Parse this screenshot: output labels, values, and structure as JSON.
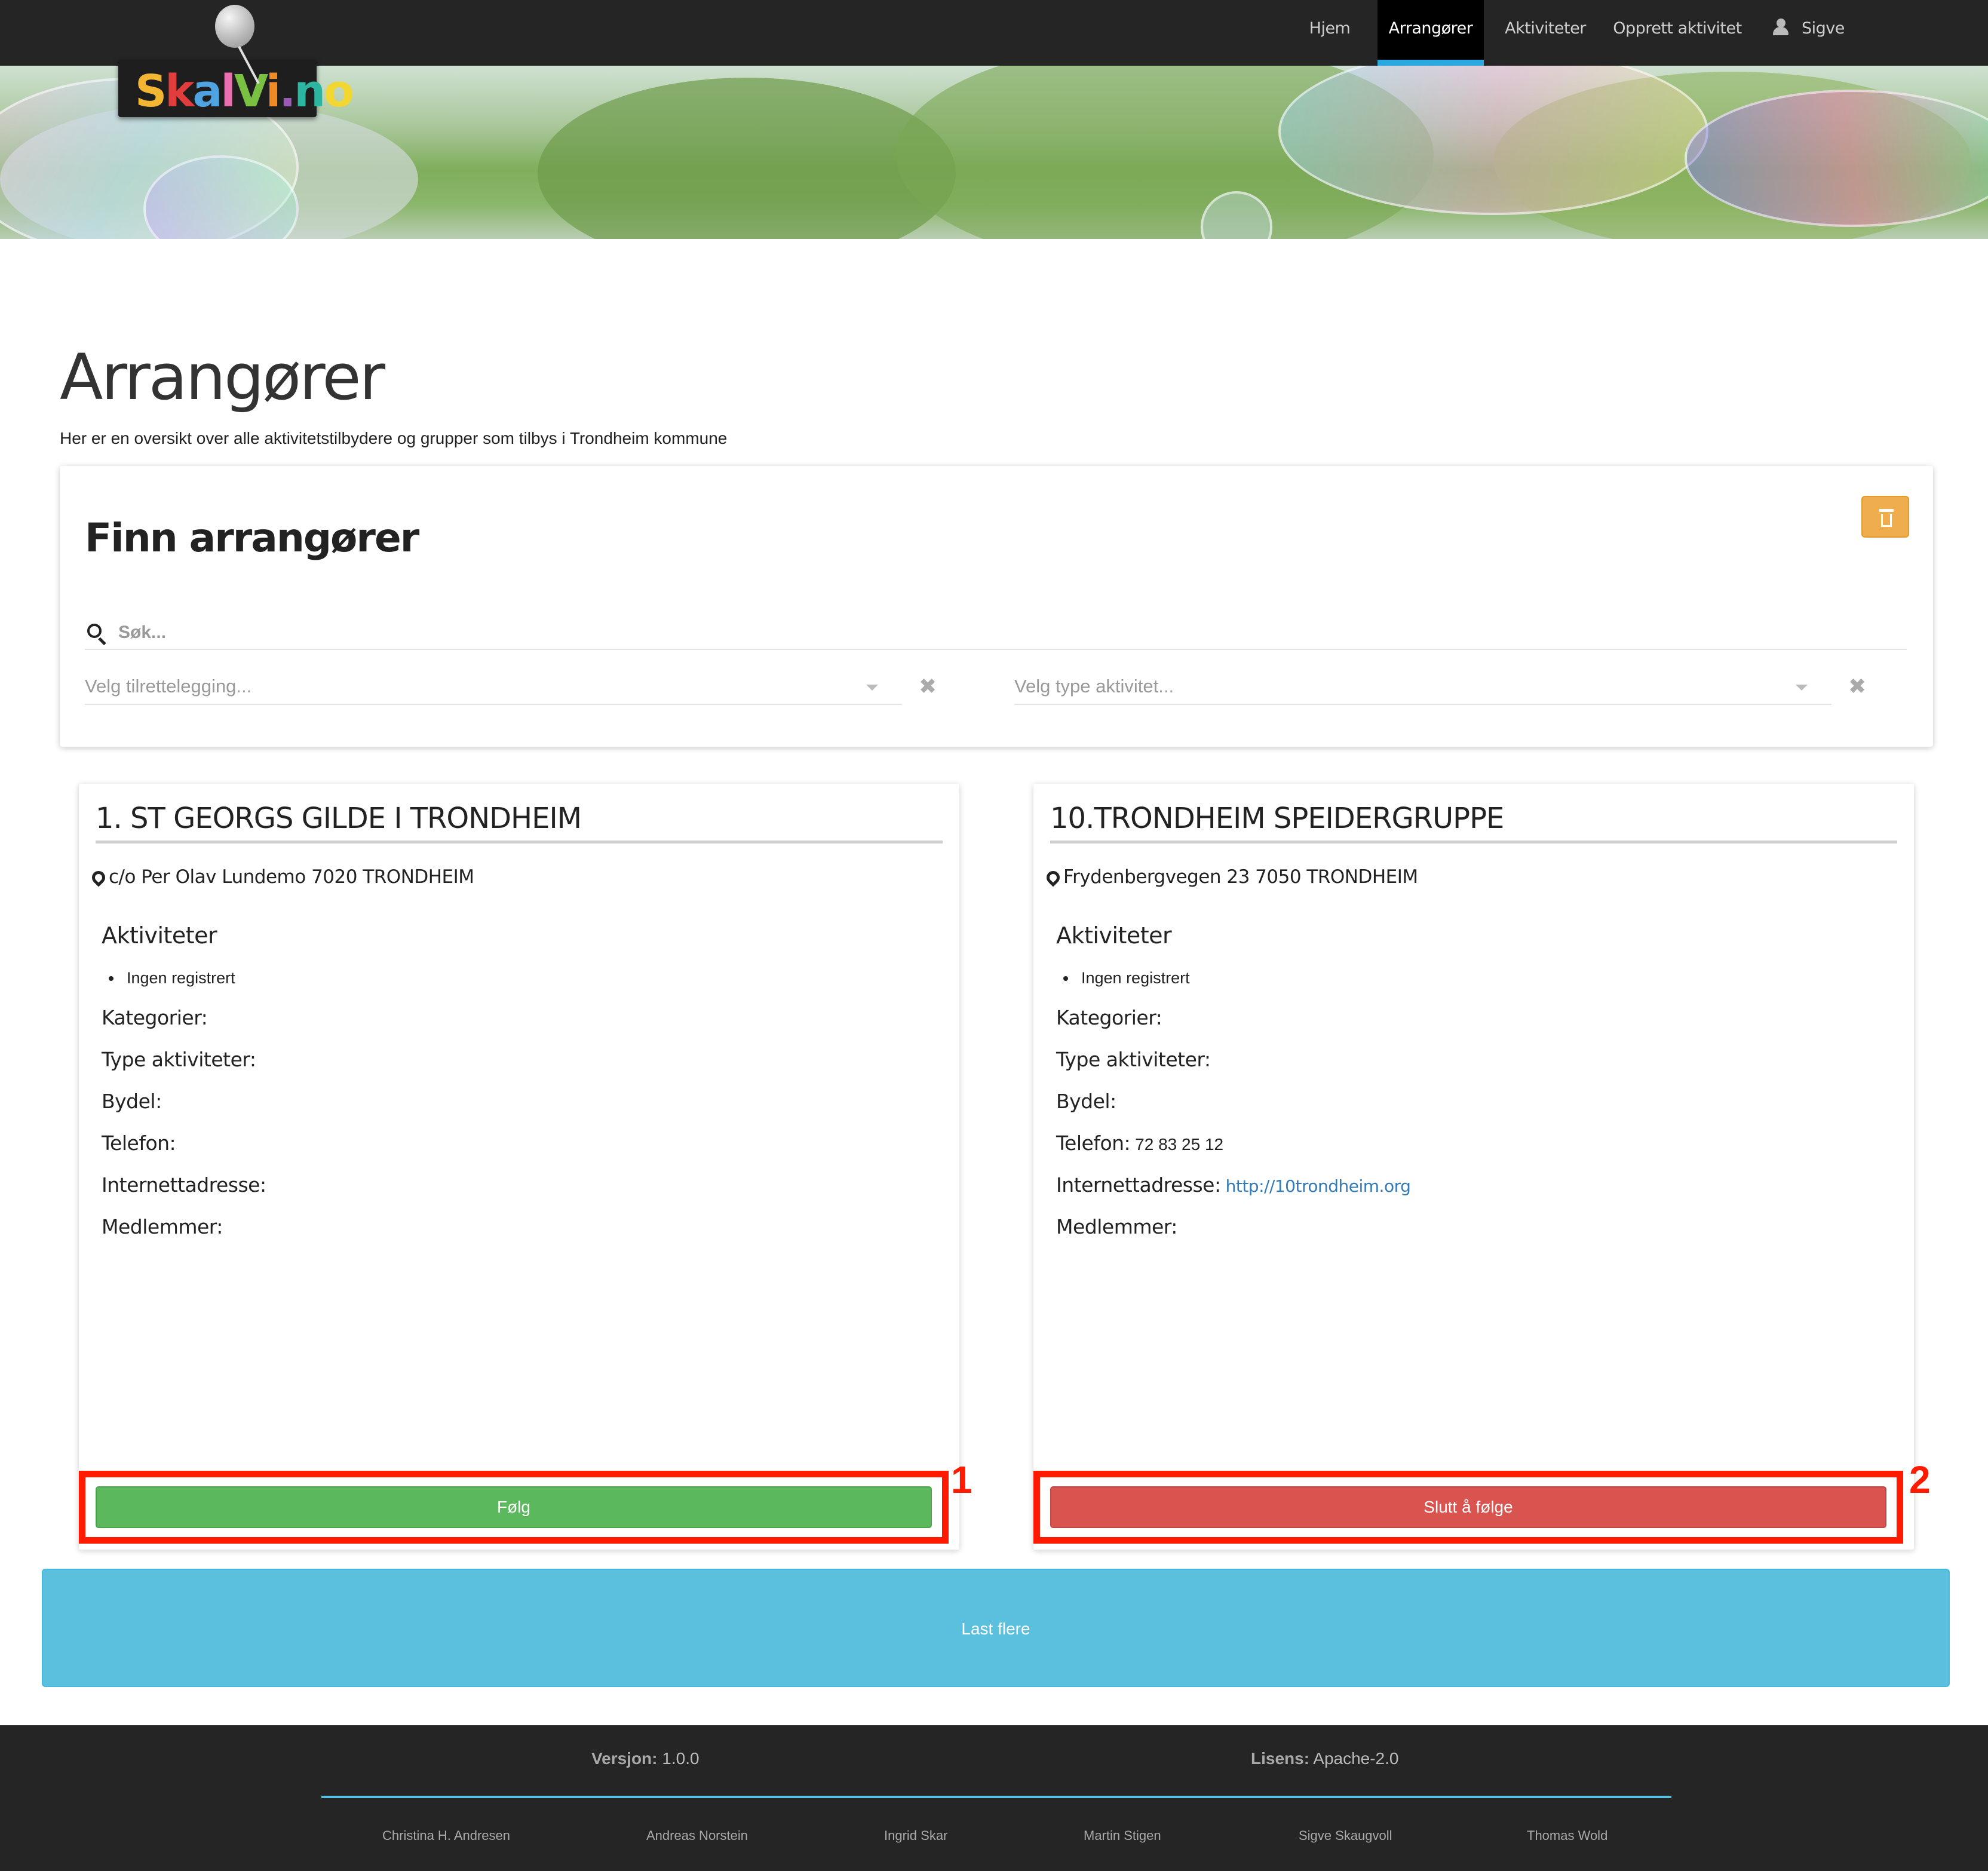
{
  "nav": {
    "items": [
      {
        "label": "Hjem"
      },
      {
        "label": "Arrangører"
      },
      {
        "label": "Aktiviteter"
      },
      {
        "label": "Opprett aktivitet"
      }
    ],
    "user": "Sigve"
  },
  "logo": {
    "text": "SkalVi.no"
  },
  "page": {
    "title": "Arrangører",
    "description": "Her er en oversikt over alle aktivitetstilbydere og grupper som tilbys i Trondheim kommune"
  },
  "search": {
    "title": "Finn arrangører",
    "placeholder": "Søk...",
    "filter1_placeholder": "Velg tilrettelegging...",
    "filter2_placeholder": "Velg type aktivitet...",
    "clear_glyph": "✖"
  },
  "cards": [
    {
      "title": "1. ST GEORGS GILDE I TRONDHEIM",
      "address": "c/o Per Olav Lundemo 7020 TRONDHEIM",
      "activities_heading": "Aktiviteter",
      "activities": [
        "Ingen registrert"
      ],
      "labels": {
        "categories": "Kategorier:",
        "types": "Type aktiviteter:",
        "district": "Bydel:",
        "phone": "Telefon:",
        "web": "Internettadresse:",
        "members": "Medlemmer:"
      },
      "phone": "",
      "web": "",
      "button": "Følg",
      "annotation": "1"
    },
    {
      "title": "10.TRONDHEIM SPEIDERGRUPPE",
      "address": "Frydenbergvegen 23 7050 TRONDHEIM",
      "activities_heading": "Aktiviteter",
      "activities": [
        "Ingen registrert"
      ],
      "labels": {
        "categories": "Kategorier:",
        "types": "Type aktiviteter:",
        "district": "Bydel:",
        "phone": "Telefon:",
        "web": "Internettadresse:",
        "members": "Medlemmer:"
      },
      "phone": "72 83 25 12",
      "web": "http://10trondheim.org",
      "button": "Slutt å følge",
      "annotation": "2"
    }
  ],
  "load_more": "Last flere",
  "footer": {
    "version_label": "Versjon:",
    "version": "1.0.0",
    "license_label": "Lisens:",
    "license": "Apache-2.0",
    "authors": [
      "Christina H. Andresen",
      "Andreas Norstein",
      "Ingrid Skar",
      "Martin Stigen",
      "Sigve Skaugvoll",
      "Thomas Wold"
    ]
  },
  "colors": {
    "nav_bg": "#252525",
    "nav_active_underline": "#2aa8e0",
    "follow": "#5cb85c",
    "unfollow": "#d9534f",
    "load_more": "#5bc0de",
    "trash": "#f0ad4e",
    "annotation": "#ff1a00"
  }
}
